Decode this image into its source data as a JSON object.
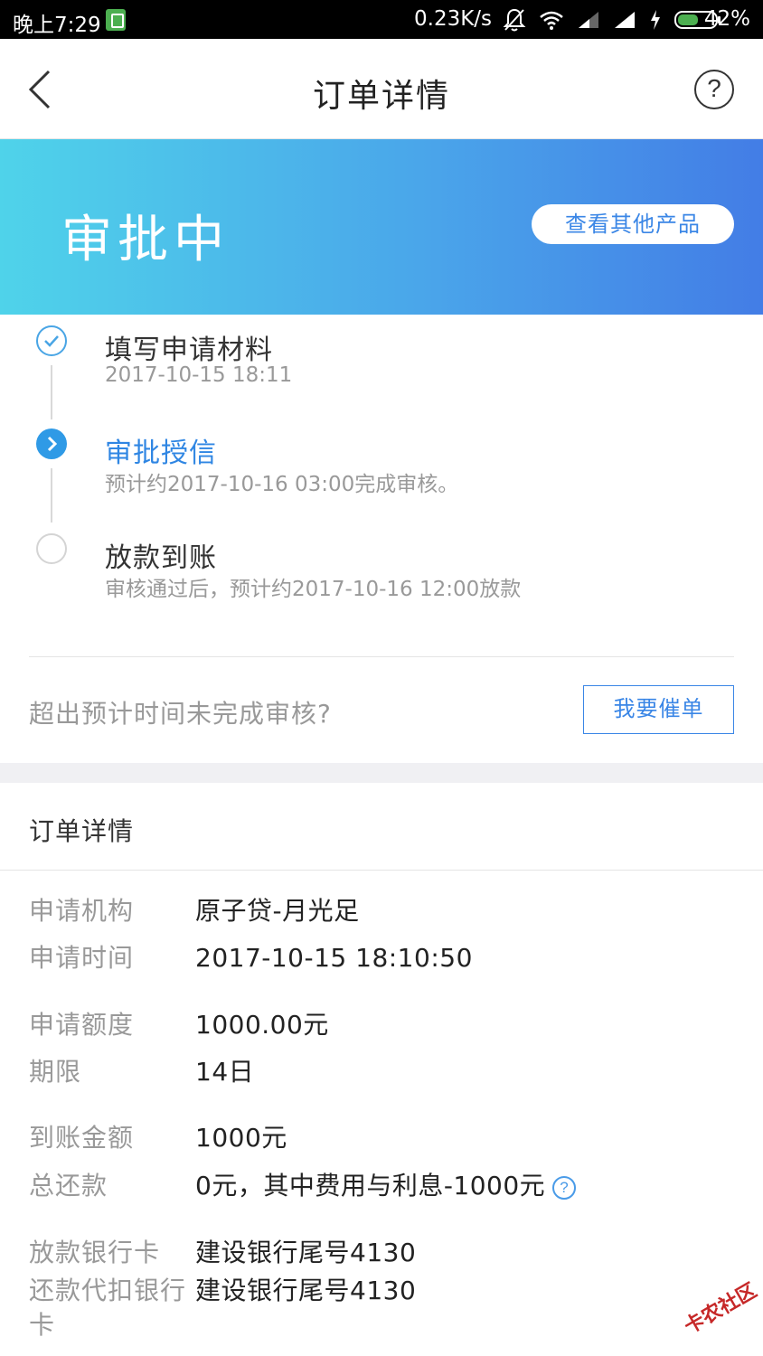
{
  "status_bar": {
    "time": "晚上7:29",
    "net_speed": "0.23K/s",
    "battery": "42%"
  },
  "nav": {
    "title": "订单详情"
  },
  "banner": {
    "status": "审批中",
    "other_products_btn": "查看其他产品"
  },
  "timeline": [
    {
      "title": "填写申请材料",
      "subtitle": "2017-10-15 18:11",
      "state": "done"
    },
    {
      "title": "审批授信",
      "subtitle": "预计约2017-10-16 03:00完成审核。",
      "state": "current"
    },
    {
      "title": "放款到账",
      "subtitle": "审核通过后，预计约2017-10-16 12:00放款",
      "state": "pending"
    }
  ],
  "urge": {
    "question": "超出预计时间未完成审核?",
    "button": "我要催单"
  },
  "details": {
    "section_title": "订单详情",
    "rows": [
      {
        "label": "申请机构",
        "value": "原子贷-月光足"
      },
      {
        "label": "申请时间",
        "value": "2017-10-15 18:10:50"
      },
      {
        "label": "申请额度",
        "value": "1000.00元"
      },
      {
        "label": "期限",
        "value": "14日"
      },
      {
        "label": "到账金额",
        "value": "1000元"
      },
      {
        "label": "总还款",
        "value": "0元，其中费用与利息-1000元"
      },
      {
        "label": "放款银行卡",
        "value": "建设银行尾号4130"
      },
      {
        "label": "还款代扣银行卡",
        "value": "建设银行尾号4130"
      }
    ]
  },
  "watermark": "卡农社区",
  "colors": {
    "accent": "#3a86e6",
    "banner_start": "#4fd3ea",
    "banner_end": "#437de6"
  }
}
